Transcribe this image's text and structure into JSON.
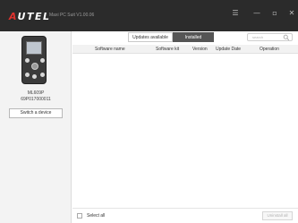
{
  "titlebar": {
    "logo_text": "AUTEL",
    "app_title": "Maxi PC Suit V1.00.06",
    "controls": {
      "menu": "☰",
      "minimize": "—",
      "maximize": "▫",
      "close": "✕"
    }
  },
  "sidebar": {
    "device_model": "ML609P",
    "device_serial": "69P017000011",
    "switch_label": "Switch a device"
  },
  "tabs": [
    {
      "label": "Updates available",
      "active": false
    },
    {
      "label": "Installed",
      "active": true
    }
  ],
  "search": {
    "placeholder": "search",
    "icon": "search-icon"
  },
  "table": {
    "columns": [
      "Software name",
      "Software kit",
      "Version",
      "Update Date",
      "Operation"
    ],
    "rows": []
  },
  "footer": {
    "select_all_label": "Select all",
    "select_all_checked": false,
    "uninstall_label": "Uninstall all"
  },
  "colors": {
    "titlebar_bg": "#2b2b2b",
    "logo_accent": "#e0312d",
    "active_tab_bg": "#555555",
    "sidebar_bg": "#f3f3f3"
  }
}
